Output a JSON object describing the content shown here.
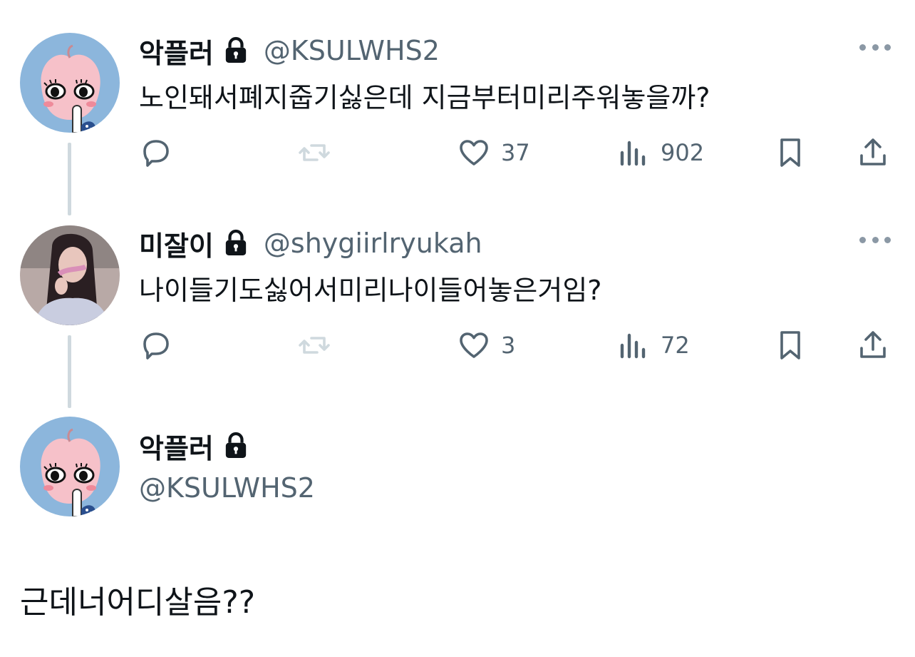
{
  "tweets": [
    {
      "name": "악플러",
      "handle": "@KSULWHS2",
      "text": "노인돼서폐지줍기싫은데 지금부터미리주워놓을까?",
      "likes": "37",
      "views": "902",
      "avatar_icon": "peach-character-avatar"
    },
    {
      "name": "미잘이",
      "handle": "@shygiirlryukah",
      "text": "나이들기도싫어서미리나이들어놓은거임?",
      "likes": "3",
      "views": "72",
      "avatar_icon": "girl-photo-avatar"
    }
  ],
  "main": {
    "name": "악플러",
    "handle": "@KSULWHS2",
    "text": "근데너어디살음??",
    "avatar_icon": "peach-character-avatar"
  },
  "colors": {
    "text": "#0f1419",
    "secondary": "#536471",
    "thread_line": "#cfd9de",
    "avatar_bg": "#8ab4dc"
  }
}
